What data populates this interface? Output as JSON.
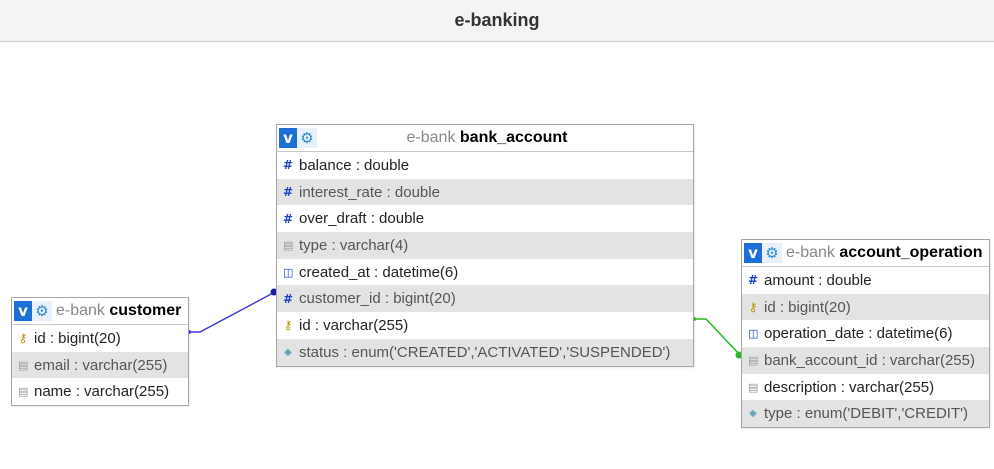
{
  "app": {
    "title": "e-banking"
  },
  "schema": "e-bank",
  "tables": {
    "customer": {
      "name": "customer",
      "columns": [
        {
          "label": "id : bigint(20)",
          "icon": "key-icon"
        },
        {
          "label": "email : varchar(255)",
          "icon": "varchar-icon"
        },
        {
          "label": "name : varchar(255)",
          "icon": "varchar-icon"
        }
      ]
    },
    "bank_account": {
      "name": "bank_account",
      "columns": [
        {
          "label": "balance : double",
          "icon": "numeric-icon"
        },
        {
          "label": "interest_rate : double",
          "icon": "numeric-icon"
        },
        {
          "label": "over_draft : double",
          "icon": "numeric-icon"
        },
        {
          "label": "type : varchar(4)",
          "icon": "varchar-icon"
        },
        {
          "label": "created_at : datetime(6)",
          "icon": "datetime-icon"
        },
        {
          "label": "customer_id : bigint(20)",
          "icon": "numeric-icon"
        },
        {
          "label": "id : varchar(255)",
          "icon": "key-icon"
        },
        {
          "label": "status : enum('CREATED','ACTIVATED','SUSPENDED')",
          "icon": "enum-icon"
        }
      ]
    },
    "account_operation": {
      "name": "account_operation",
      "columns": [
        {
          "label": "amount : double",
          "icon": "numeric-icon"
        },
        {
          "label": "id : bigint(20)",
          "icon": "key-icon"
        },
        {
          "label": "operation_date : datetime(6)",
          "icon": "datetime-icon"
        },
        {
          "label": "bank_account_id : varchar(255)",
          "icon": "varchar-icon"
        },
        {
          "label": "description : varchar(255)",
          "icon": "varchar-icon"
        },
        {
          "label": "type : enum('DEBIT','CREDIT')",
          "icon": "enum-icon"
        }
      ]
    }
  },
  "buttons": {
    "v_label": "v",
    "gear_glyph": "⚙"
  },
  "colors": {
    "relation_customer": "#3b3bd6",
    "relation_account": "#22bb22",
    "v_button": "#1c6fd6",
    "alt_row": "#e3e3e3"
  }
}
